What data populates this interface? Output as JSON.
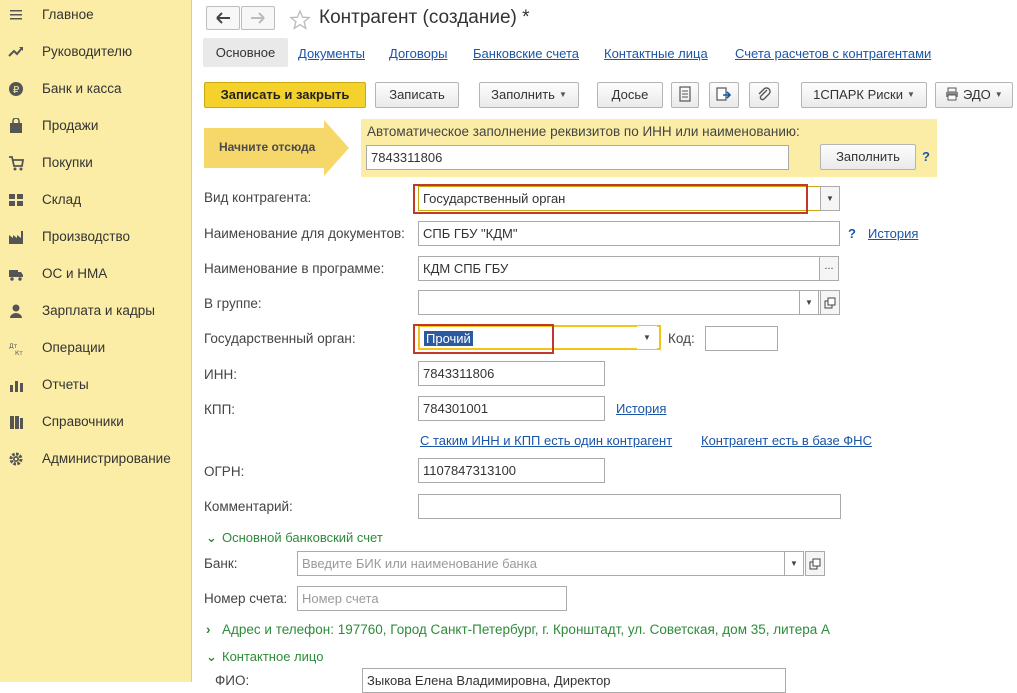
{
  "sidebar": {
    "items": [
      {
        "label": "Главное",
        "icon": "menu-lines-icon"
      },
      {
        "label": "Руководителю",
        "icon": "trend-arrow-icon"
      },
      {
        "label": "Банк и касса",
        "icon": "ruble-coin-icon"
      },
      {
        "label": "Продажи",
        "icon": "shopping-bag-icon"
      },
      {
        "label": "Покупки",
        "icon": "cart-icon"
      },
      {
        "label": "Склад",
        "icon": "warehouse-icon"
      },
      {
        "label": "Производство",
        "icon": "factory-icon"
      },
      {
        "label": "ОС и НМА",
        "icon": "truck-icon"
      },
      {
        "label": "Зарплата и кадры",
        "icon": "person-icon"
      },
      {
        "label": "Операции",
        "icon": "dt-kt-icon"
      },
      {
        "label": "Отчеты",
        "icon": "bar-chart-icon"
      },
      {
        "label": "Справочники",
        "icon": "books-icon"
      },
      {
        "label": "Администрирование",
        "icon": "gear-icon"
      }
    ]
  },
  "header": {
    "title": "Контрагент (создание) *"
  },
  "tabs": [
    {
      "label": "Основное"
    },
    {
      "label": "Документы"
    },
    {
      "label": "Договоры"
    },
    {
      "label": "Банковские счета"
    },
    {
      "label": "Контактные лица"
    },
    {
      "label": "Счета расчетов с контрагентами"
    }
  ],
  "toolbar": {
    "save_close": "Записать и закрыть",
    "save": "Записать",
    "fill": "Заполнить",
    "dossier": "Досье",
    "spark": "1СПАРК Риски",
    "edo": "ЭДО"
  },
  "autofill": {
    "start_here": "Начните отсюда",
    "caption": "Автоматическое заполнение реквизитов по ИНН или наименованию:",
    "value": "7843311806",
    "button": "Заполнить",
    "help": "?"
  },
  "form": {
    "type_label": "Вид контрагента:",
    "type_value": "Государственный орган",
    "docname_label": "Наименование для документов:",
    "docname_value": "СПБ ГБУ \"КДМ\"",
    "docname_help": "?",
    "history_link": "История",
    "progname_label": "Наименование в программе:",
    "progname_value": "КДМ СПБ ГБУ",
    "progname_button": "...",
    "group_label": "В группе:",
    "group_value": "",
    "gov_label": "Государственный орган:",
    "gov_value": "Прочий",
    "code_label": "Код:",
    "code_value": "",
    "inn_label": "ИНН:",
    "inn_value": "7843311806",
    "kpp_label": "КПП:",
    "kpp_value": "784301001",
    "kpp_history": "История",
    "inn_kpp_link": "С таким ИНН и КПП есть один контрагент",
    "fns_link": "Контрагент есть в базе ФНС",
    "ogrn_label": "ОГРН:",
    "ogrn_value": "1107847313100",
    "comment_label": "Комментарий:",
    "comment_value": ""
  },
  "bank_section": {
    "title": "Основной банковский счет",
    "bank_label": "Банк:",
    "bank_placeholder": "Введите БИК или наименование банка",
    "account_label": "Номер счета:",
    "account_placeholder": "Номер счета"
  },
  "address_section": {
    "title": "Адрес и телефон: 197760, Город Санкт-Петербург, г. Кронштадт, ул. Советская, дом 35, литера А"
  },
  "contact_section": {
    "title": "Контактное лицо",
    "fio_label": "ФИО:",
    "fio_value": "Зыкова Елена Владимировна, Директор"
  }
}
